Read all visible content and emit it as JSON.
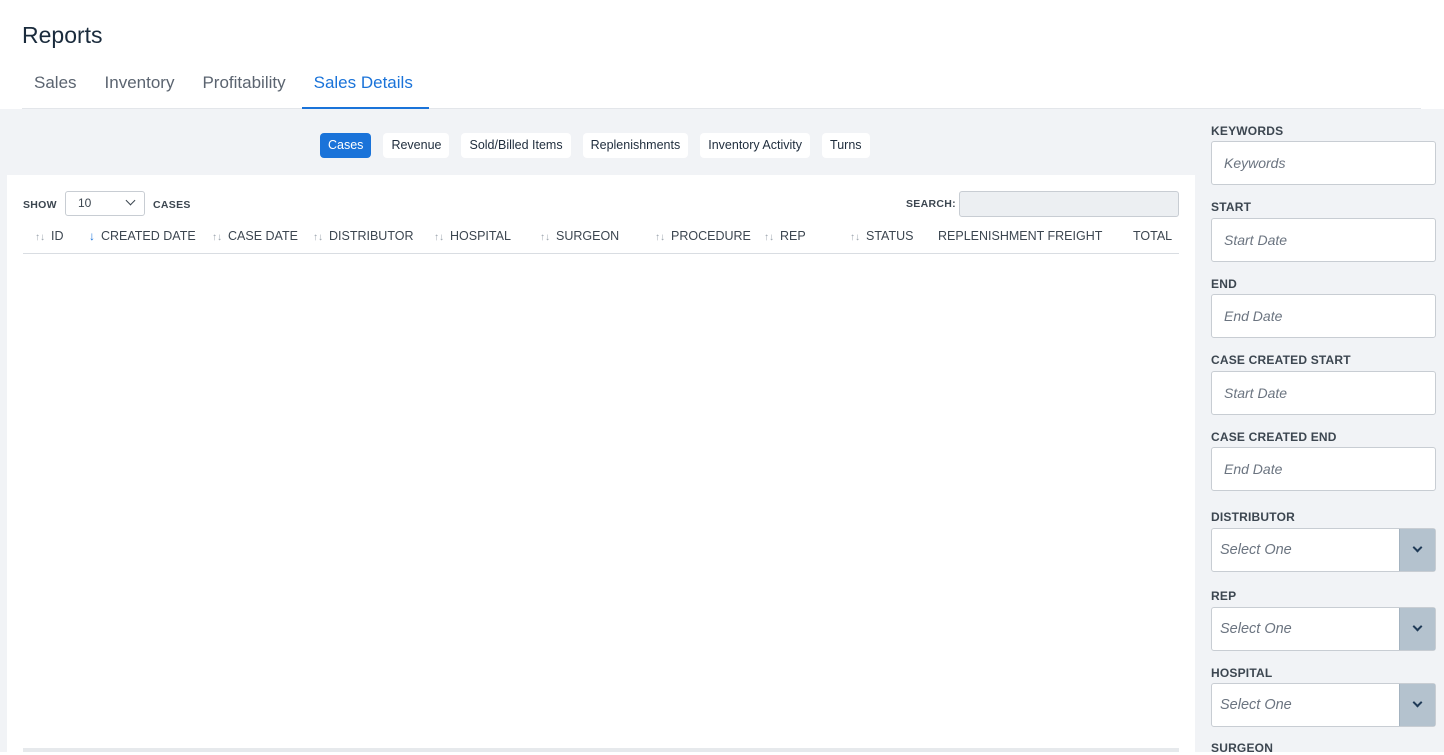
{
  "page": {
    "title": "Reports"
  },
  "tabs": [
    {
      "label": "Sales",
      "active": false
    },
    {
      "label": "Inventory",
      "active": false
    },
    {
      "label": "Profitability",
      "active": false
    },
    {
      "label": "Sales Details",
      "active": true
    }
  ],
  "subtabs": [
    {
      "label": "Cases",
      "active": true
    },
    {
      "label": "Revenue",
      "active": false
    },
    {
      "label": "Sold/Billed Items",
      "active": false
    },
    {
      "label": "Replenishments",
      "active": false
    },
    {
      "label": "Inventory Activity",
      "active": false
    },
    {
      "label": "Turns",
      "active": false
    }
  ],
  "table": {
    "show_label": "SHOW",
    "page_size": "10",
    "cases_label": "CASES",
    "search_label": "SEARCH:",
    "search_value": "",
    "columns": [
      {
        "label": "ID",
        "sort": "both"
      },
      {
        "label": "CREATED DATE",
        "sort": "desc"
      },
      {
        "label": "CASE DATE",
        "sort": "both"
      },
      {
        "label": "DISTRIBUTOR",
        "sort": "both"
      },
      {
        "label": "HOSPITAL",
        "sort": "both"
      },
      {
        "label": "SURGEON",
        "sort": "both"
      },
      {
        "label": "PROCEDURE",
        "sort": "both"
      },
      {
        "label": "REP",
        "sort": "both"
      },
      {
        "label": "STATUS",
        "sort": "both"
      },
      {
        "label": "REPLENISHMENT FREIGHT",
        "sort": "none"
      },
      {
        "label": "TOTAL",
        "sort": "none"
      }
    ],
    "rows": []
  },
  "filters": {
    "keywords": {
      "label": "KEYWORDS",
      "placeholder": "Keywords"
    },
    "start": {
      "label": "START",
      "placeholder": "Start Date"
    },
    "end": {
      "label": "END",
      "placeholder": "End Date"
    },
    "case_created_start": {
      "label": "CASE CREATED START",
      "placeholder": "Start Date"
    },
    "case_created_end": {
      "label": "CASE CREATED END",
      "placeholder": "End Date"
    },
    "distributor": {
      "label": "DISTRIBUTOR",
      "placeholder": "Select One"
    },
    "rep": {
      "label": "REP",
      "placeholder": "Select One"
    },
    "hospital": {
      "label": "HOSPITAL",
      "placeholder": "Select One"
    },
    "surgeon": {
      "label": "SURGEON"
    }
  },
  "icons": {
    "sort_both": "sort-arrows-icon",
    "sort_desc": "arrow-down-icon",
    "dropdown": "chevron-down-icon"
  },
  "colors": {
    "accent": "#1a73d9",
    "background": "#f1f3f6",
    "select_button": "#b4c2ce"
  }
}
